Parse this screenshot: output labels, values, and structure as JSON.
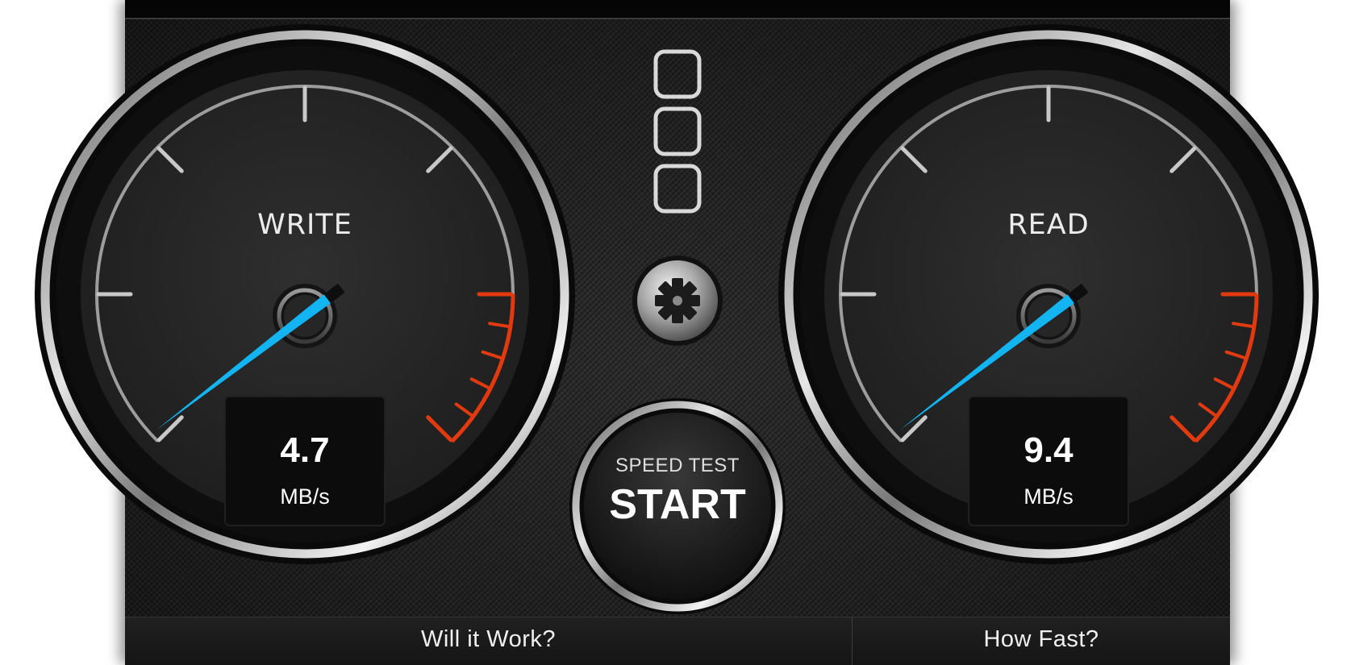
{
  "write_gauge": {
    "label": "WRITE",
    "value": "4.7",
    "unit": "MB/s",
    "needle_fraction": 0.07
  },
  "read_gauge": {
    "label": "READ",
    "value": "9.4",
    "unit": "MB/s",
    "needle_fraction": 0.1
  },
  "start_button": {
    "subtitle": "SPEED TEST",
    "label": "START"
  },
  "settings_icon": "gear-icon",
  "drive_indicator_icon": "stacked-squares-icon",
  "bottom_tabs": [
    {
      "label": "Will it Work?"
    },
    {
      "label": "How Fast?"
    }
  ],
  "colors": {
    "needle": "#13b4f2",
    "redline": "#e23a10",
    "chrome": "#c9c9c9"
  }
}
